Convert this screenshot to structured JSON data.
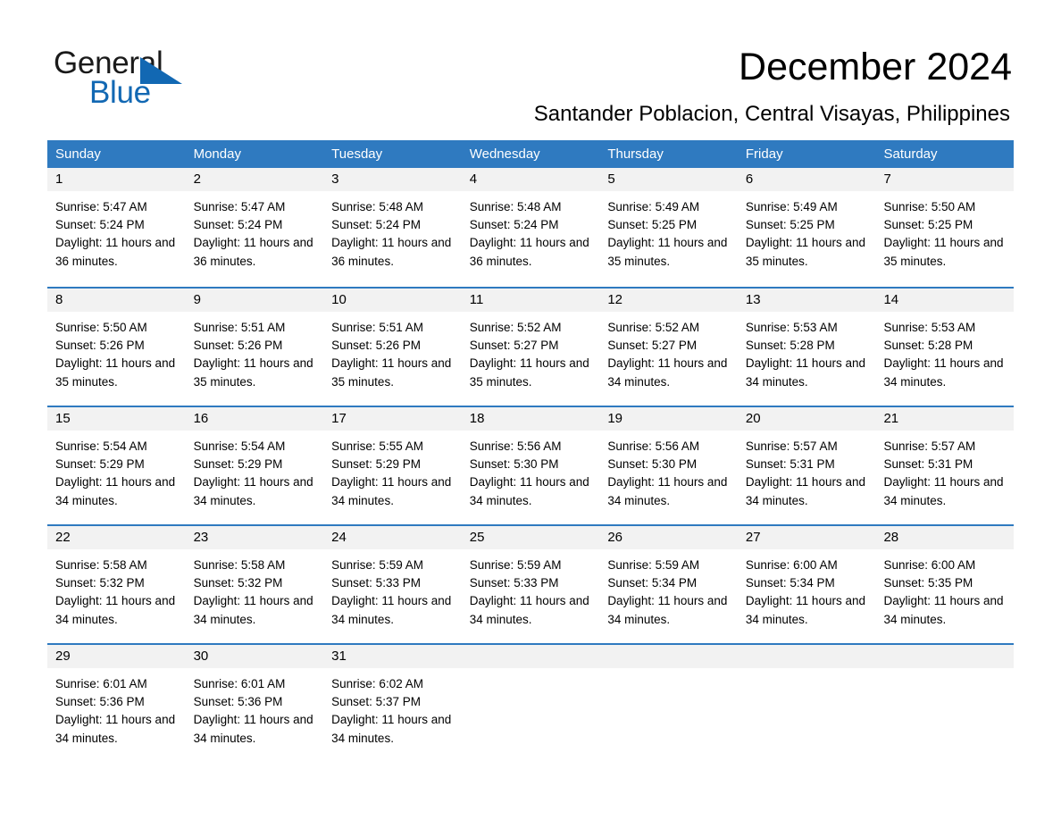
{
  "brand": {
    "name_top": "General",
    "name_bottom": "Blue",
    "accent_color": "#1268b3"
  },
  "header": {
    "month_title": "December 2024",
    "location": "Santander Poblacion, Central Visayas, Philippines"
  },
  "theme": {
    "header_bar_color": "#2f7ac0",
    "day_number_band_color": "#f2f2f2",
    "row_divider_color": "#2f7ac0"
  },
  "day_headers": [
    "Sunday",
    "Monday",
    "Tuesday",
    "Wednesday",
    "Thursday",
    "Friday",
    "Saturday"
  ],
  "weeks": [
    [
      {
        "day": "1",
        "sunrise": "Sunrise: 5:47 AM",
        "sunset": "Sunset: 5:24 PM",
        "daylight": "Daylight: 11 hours and 36 minutes."
      },
      {
        "day": "2",
        "sunrise": "Sunrise: 5:47 AM",
        "sunset": "Sunset: 5:24 PM",
        "daylight": "Daylight: 11 hours and 36 minutes."
      },
      {
        "day": "3",
        "sunrise": "Sunrise: 5:48 AM",
        "sunset": "Sunset: 5:24 PM",
        "daylight": "Daylight: 11 hours and 36 minutes."
      },
      {
        "day": "4",
        "sunrise": "Sunrise: 5:48 AM",
        "sunset": "Sunset: 5:24 PM",
        "daylight": "Daylight: 11 hours and 36 minutes."
      },
      {
        "day": "5",
        "sunrise": "Sunrise: 5:49 AM",
        "sunset": "Sunset: 5:25 PM",
        "daylight": "Daylight: 11 hours and 35 minutes."
      },
      {
        "day": "6",
        "sunrise": "Sunrise: 5:49 AM",
        "sunset": "Sunset: 5:25 PM",
        "daylight": "Daylight: 11 hours and 35 minutes."
      },
      {
        "day": "7",
        "sunrise": "Sunrise: 5:50 AM",
        "sunset": "Sunset: 5:25 PM",
        "daylight": "Daylight: 11 hours and 35 minutes."
      }
    ],
    [
      {
        "day": "8",
        "sunrise": "Sunrise: 5:50 AM",
        "sunset": "Sunset: 5:26 PM",
        "daylight": "Daylight: 11 hours and 35 minutes."
      },
      {
        "day": "9",
        "sunrise": "Sunrise: 5:51 AM",
        "sunset": "Sunset: 5:26 PM",
        "daylight": "Daylight: 11 hours and 35 minutes."
      },
      {
        "day": "10",
        "sunrise": "Sunrise: 5:51 AM",
        "sunset": "Sunset: 5:26 PM",
        "daylight": "Daylight: 11 hours and 35 minutes."
      },
      {
        "day": "11",
        "sunrise": "Sunrise: 5:52 AM",
        "sunset": "Sunset: 5:27 PM",
        "daylight": "Daylight: 11 hours and 35 minutes."
      },
      {
        "day": "12",
        "sunrise": "Sunrise: 5:52 AM",
        "sunset": "Sunset: 5:27 PM",
        "daylight": "Daylight: 11 hours and 34 minutes."
      },
      {
        "day": "13",
        "sunrise": "Sunrise: 5:53 AM",
        "sunset": "Sunset: 5:28 PM",
        "daylight": "Daylight: 11 hours and 34 minutes."
      },
      {
        "day": "14",
        "sunrise": "Sunrise: 5:53 AM",
        "sunset": "Sunset: 5:28 PM",
        "daylight": "Daylight: 11 hours and 34 minutes."
      }
    ],
    [
      {
        "day": "15",
        "sunrise": "Sunrise: 5:54 AM",
        "sunset": "Sunset: 5:29 PM",
        "daylight": "Daylight: 11 hours and 34 minutes."
      },
      {
        "day": "16",
        "sunrise": "Sunrise: 5:54 AM",
        "sunset": "Sunset: 5:29 PM",
        "daylight": "Daylight: 11 hours and 34 minutes."
      },
      {
        "day": "17",
        "sunrise": "Sunrise: 5:55 AM",
        "sunset": "Sunset: 5:29 PM",
        "daylight": "Daylight: 11 hours and 34 minutes."
      },
      {
        "day": "18",
        "sunrise": "Sunrise: 5:56 AM",
        "sunset": "Sunset: 5:30 PM",
        "daylight": "Daylight: 11 hours and 34 minutes."
      },
      {
        "day": "19",
        "sunrise": "Sunrise: 5:56 AM",
        "sunset": "Sunset: 5:30 PM",
        "daylight": "Daylight: 11 hours and 34 minutes."
      },
      {
        "day": "20",
        "sunrise": "Sunrise: 5:57 AM",
        "sunset": "Sunset: 5:31 PM",
        "daylight": "Daylight: 11 hours and 34 minutes."
      },
      {
        "day": "21",
        "sunrise": "Sunrise: 5:57 AM",
        "sunset": "Sunset: 5:31 PM",
        "daylight": "Daylight: 11 hours and 34 minutes."
      }
    ],
    [
      {
        "day": "22",
        "sunrise": "Sunrise: 5:58 AM",
        "sunset": "Sunset: 5:32 PM",
        "daylight": "Daylight: 11 hours and 34 minutes."
      },
      {
        "day": "23",
        "sunrise": "Sunrise: 5:58 AM",
        "sunset": "Sunset: 5:32 PM",
        "daylight": "Daylight: 11 hours and 34 minutes."
      },
      {
        "day": "24",
        "sunrise": "Sunrise: 5:59 AM",
        "sunset": "Sunset: 5:33 PM",
        "daylight": "Daylight: 11 hours and 34 minutes."
      },
      {
        "day": "25",
        "sunrise": "Sunrise: 5:59 AM",
        "sunset": "Sunset: 5:33 PM",
        "daylight": "Daylight: 11 hours and 34 minutes."
      },
      {
        "day": "26",
        "sunrise": "Sunrise: 5:59 AM",
        "sunset": "Sunset: 5:34 PM",
        "daylight": "Daylight: 11 hours and 34 minutes."
      },
      {
        "day": "27",
        "sunrise": "Sunrise: 6:00 AM",
        "sunset": "Sunset: 5:34 PM",
        "daylight": "Daylight: 11 hours and 34 minutes."
      },
      {
        "day": "28",
        "sunrise": "Sunrise: 6:00 AM",
        "sunset": "Sunset: 5:35 PM",
        "daylight": "Daylight: 11 hours and 34 minutes."
      }
    ],
    [
      {
        "day": "29",
        "sunrise": "Sunrise: 6:01 AM",
        "sunset": "Sunset: 5:36 PM",
        "daylight": "Daylight: 11 hours and 34 minutes."
      },
      {
        "day": "30",
        "sunrise": "Sunrise: 6:01 AM",
        "sunset": "Sunset: 5:36 PM",
        "daylight": "Daylight: 11 hours and 34 minutes."
      },
      {
        "day": "31",
        "sunrise": "Sunrise: 6:02 AM",
        "sunset": "Sunset: 5:37 PM",
        "daylight": "Daylight: 11 hours and 34 minutes."
      },
      {
        "day": "",
        "sunrise": "",
        "sunset": "",
        "daylight": ""
      },
      {
        "day": "",
        "sunrise": "",
        "sunset": "",
        "daylight": ""
      },
      {
        "day": "",
        "sunrise": "",
        "sunset": "",
        "daylight": ""
      },
      {
        "day": "",
        "sunrise": "",
        "sunset": "",
        "daylight": ""
      }
    ]
  ]
}
